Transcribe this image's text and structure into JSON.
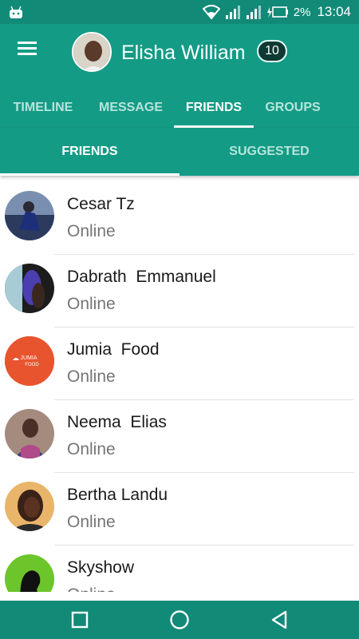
{
  "status_bar": {
    "battery_percent": "2%",
    "time": "13:04"
  },
  "header": {
    "user_name": "Elisha William",
    "notification_count": "10"
  },
  "tabs": [
    {
      "label": "TIMELINE",
      "active": false
    },
    {
      "label": "MESSAGE",
      "active": false
    },
    {
      "label": "FRIENDS",
      "active": true
    },
    {
      "label": "GROUPS",
      "active": false
    }
  ],
  "subtabs": [
    {
      "label": "FRIENDS",
      "active": true
    },
    {
      "label": "SUGGESTED",
      "active": false
    }
  ],
  "friends": [
    {
      "name": "Cesar Tz",
      "status": "Online"
    },
    {
      "name": "Dabrath  Emmanuel",
      "status": "Online"
    },
    {
      "name": "Jumia  Food",
      "status": "Online",
      "logo_text": "JUMIA FOOD"
    },
    {
      "name": "Neema  Elias",
      "status": "Online"
    },
    {
      "name": "Bertha Landu",
      "status": "Online"
    },
    {
      "name": "Skyshow",
      "status": "Online"
    }
  ],
  "colors": {
    "primary": "#149b86",
    "primary_dark": "#128a78",
    "badge": "#0f3a33",
    "jumia_orange": "#e8542e"
  },
  "icons": {
    "menu": "menu-icon",
    "nav_recent": "square-icon",
    "nav_home": "circle-icon",
    "nav_back": "triangle-back-icon"
  }
}
